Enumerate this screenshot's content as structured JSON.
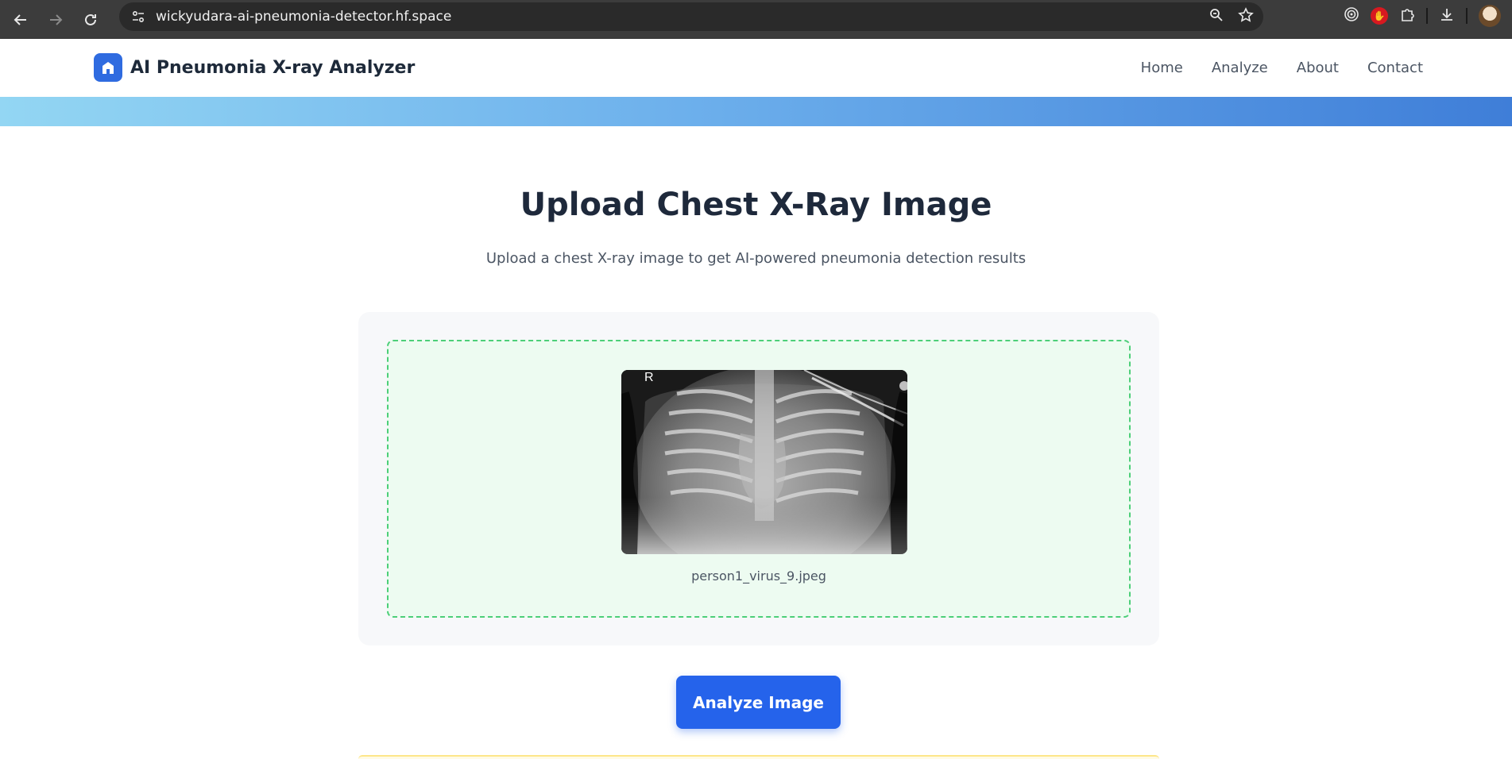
{
  "browser": {
    "url": "wickyudara-ai-pneumonia-detector.hf.space"
  },
  "header": {
    "brand_title": "AI Pneumonia X-ray Analyzer",
    "nav": [
      "Home",
      "Analyze",
      "About",
      "Contact"
    ]
  },
  "main": {
    "title": "Upload Chest X-Ray Image",
    "subtitle": "Upload a chest X-ray image to get AI-powered pneumonia detection results",
    "preview": {
      "marker_label": "R",
      "file_name": "person1_virus_9.jpeg"
    },
    "analyze_button_label": "Analyze Image"
  },
  "colors": {
    "accent": "#2563eb",
    "dropzone_border": "#4ccf78",
    "dropzone_bg": "#edfbf1"
  }
}
